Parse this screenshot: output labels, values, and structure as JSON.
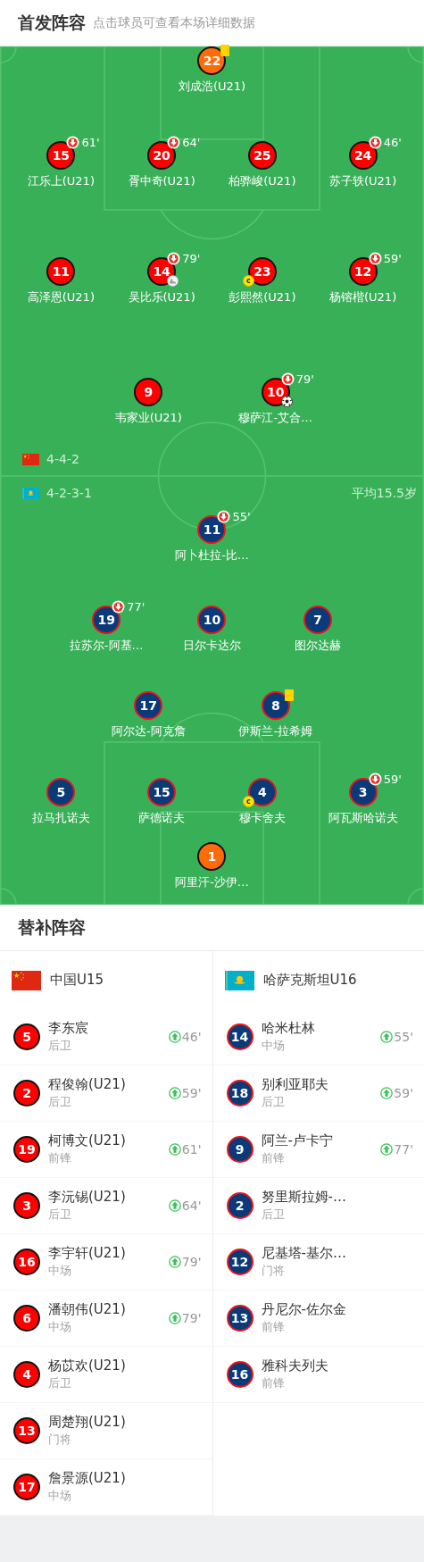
{
  "header": {
    "title": "首发阵容",
    "subtitle": "点击球员可查看本场详细数据"
  },
  "pitch": {
    "home": {
      "kind": "home",
      "flag": {
        "kind": "china"
      },
      "formation": "4-4-2",
      "lines": [
        [
          {
            "number": "22",
            "name": "刘成浩(U21)",
            "kind": "goalkeeper",
            "yellow_card": true
          }
        ],
        [
          {
            "number": "15",
            "name": "江乐上(U21)",
            "kind": "outfield",
            "sub_off": "61'"
          },
          {
            "number": "20",
            "name": "胥中奇(U21)",
            "kind": "outfield",
            "sub_off": "64'"
          },
          {
            "number": "25",
            "name": "柏骅峻(U21)",
            "kind": "outfield"
          },
          {
            "number": "24",
            "name": "苏子轶(U21)",
            "kind": "outfield",
            "sub_off": "46'"
          }
        ],
        [
          {
            "number": "11",
            "name": "高泽恩(U21)",
            "kind": "outfield"
          },
          {
            "number": "14",
            "name": "吴比乐(U21)",
            "kind": "outfield",
            "sub_off": "79'",
            "assist": true
          },
          {
            "number": "23",
            "name": "彭熙然(U21)",
            "kind": "outfield",
            "captain": "c"
          },
          {
            "number": "12",
            "name": "杨镕楷(U21)",
            "kind": "outfield",
            "sub_off": "59'"
          }
        ],
        [
          {
            "number": "9",
            "name": "韦家业(U21)",
            "kind": "outfield"
          },
          {
            "number": "10",
            "name": "穆萨江-艾合…",
            "kind": "outfield",
            "sub_off": "79'",
            "goal": true
          }
        ]
      ]
    },
    "away": {
      "kind": "away",
      "flag": {
        "kind": "kazakhstan"
      },
      "formation": "4-2-3-1",
      "average_age": "平均15.5岁",
      "lines": [
        [
          {
            "number": "11",
            "name": "阿卜杜拉-比…",
            "kind": "outfield",
            "sub_off": "55'"
          }
        ],
        [
          {
            "number": "19",
            "name": "拉苏尔-阿基…",
            "kind": "outfield",
            "sub_off": "77'"
          },
          {
            "number": "10",
            "name": "日尔卡达尔",
            "kind": "outfield"
          },
          {
            "number": "7",
            "name": "图尔达赫",
            "kind": "outfield"
          }
        ],
        [
          {
            "number": "17",
            "name": "阿尔达-阿克詹",
            "kind": "outfield"
          },
          {
            "number": "8",
            "name": "伊斯兰-拉希姆",
            "kind": "outfield",
            "yellow_card": true
          }
        ],
        [
          {
            "number": "5",
            "name": "拉马扎诺夫",
            "kind": "outfield"
          },
          {
            "number": "15",
            "name": "萨德诺夫",
            "kind": "outfield"
          },
          {
            "number": "4",
            "name": "穆卡舍夫",
            "kind": "outfield",
            "captain": "c"
          },
          {
            "number": "3",
            "name": "阿瓦斯哈诺夫",
            "kind": "outfield",
            "sub_off": "59'"
          }
        ],
        [
          {
            "number": "1",
            "name": "阿里汗-沙伊…",
            "kind": "goalkeeper"
          }
        ]
      ]
    }
  },
  "substitutes": {
    "title": "替补阵容",
    "teams": [
      {
        "kind": "home",
        "flag": {
          "kind": "china"
        },
        "name": "中国U15",
        "players": [
          {
            "number": "5",
            "name": "李东宸",
            "position": "后卫",
            "sub_on": "46'"
          },
          {
            "number": "2",
            "name": "程俊翰(U21)",
            "position": "后卫",
            "sub_on": "59'"
          },
          {
            "number": "19",
            "name": "柯博文(U21)",
            "position": "前锋",
            "sub_on": "61'"
          },
          {
            "number": "3",
            "name": "李沅锡(U21)",
            "position": "后卫",
            "sub_on": "64'"
          },
          {
            "number": "16",
            "name": "李宇轩(U21)",
            "position": "中场",
            "sub_on": "79'"
          },
          {
            "number": "6",
            "name": "潘朝伟(U21)",
            "position": "中场",
            "sub_on": "79'"
          },
          {
            "number": "4",
            "name": "杨苡欢(U21)",
            "position": "后卫"
          },
          {
            "number": "13",
            "name": "周楚翔(U21)",
            "position": "门将"
          },
          {
            "number": "17",
            "name": "詹景源(U21)",
            "position": "中场"
          }
        ]
      },
      {
        "kind": "away",
        "flag": {
          "kind": "kazakhstan"
        },
        "name": "哈萨克斯坦U16",
        "players": [
          {
            "number": "14",
            "name": "哈米杜林",
            "position": "中场",
            "sub_on": "55'"
          },
          {
            "number": "18",
            "name": "别利亚耶夫",
            "position": "后卫",
            "sub_on": "59'"
          },
          {
            "number": "9",
            "name": "阿兰-卢卡宁",
            "position": "前锋",
            "sub_on": "77'"
          },
          {
            "number": "2",
            "name": "努里斯拉姆-…",
            "position": "后卫"
          },
          {
            "number": "12",
            "name": "尼基塔-基尔…",
            "position": "门将"
          },
          {
            "number": "13",
            "name": "丹尼尔-佐尔金",
            "position": "前锋"
          },
          {
            "number": "16",
            "name": "雅科夫列夫",
            "position": "前锋"
          }
        ]
      }
    ]
  }
}
